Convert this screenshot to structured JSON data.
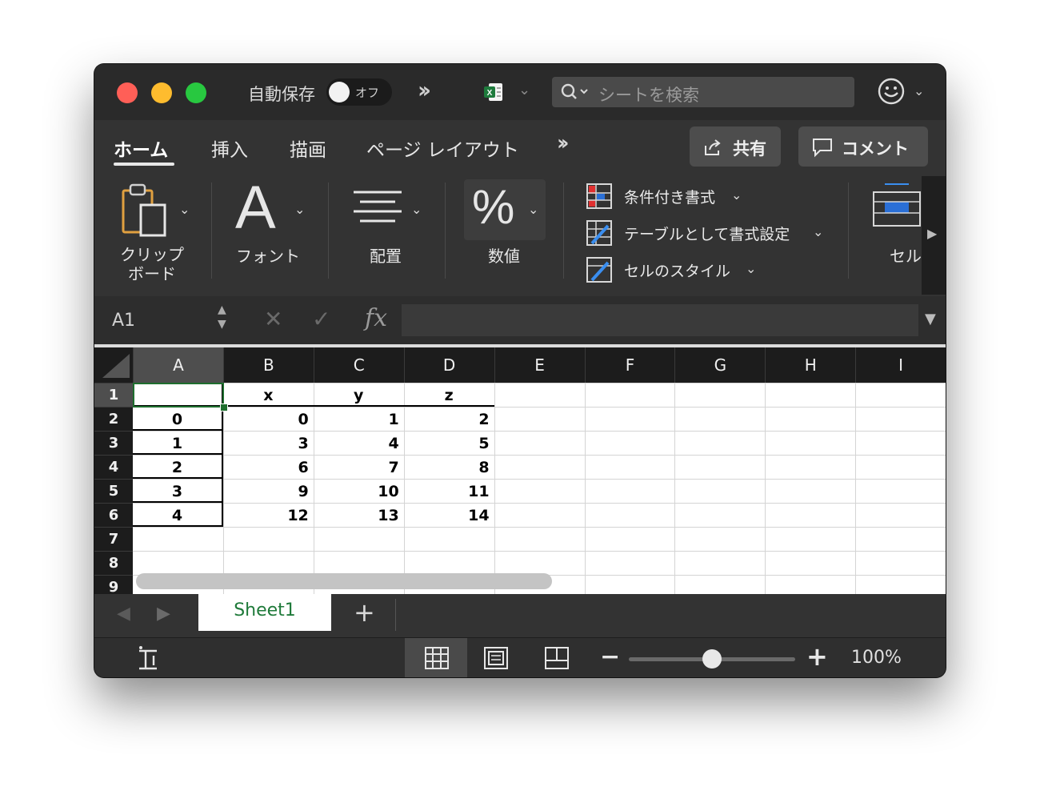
{
  "titlebar": {
    "autosave_label": "自動保存",
    "toggle_state": "オフ",
    "search_placeholder": "シートを検索"
  },
  "tabs": [
    "ホーム",
    "挿入",
    "描画",
    "ページ レイアウト"
  ],
  "actions": {
    "share": "共有",
    "comment": "コメント"
  },
  "ribbon": {
    "clipboard_line1": "クリップ",
    "clipboard_line2": "ボード",
    "font_glyph": "A",
    "font_label": "フォント",
    "align_label": "配置",
    "number_glyph": "%",
    "number_label": "数値",
    "styles": [
      "条件付き書式",
      "テーブルとして書式設定",
      "セルのスタイル"
    ],
    "cells_label": "セル"
  },
  "formula_bar": {
    "name_box": "A1",
    "fx": "fx",
    "content": ""
  },
  "grid": {
    "columns": [
      "A",
      "B",
      "C",
      "D",
      "E",
      "F",
      "G",
      "H",
      "I"
    ],
    "rows": [
      "1",
      "2",
      "3",
      "4",
      "5",
      "6",
      "7",
      "8",
      "9"
    ],
    "header_cells": [
      "",
      "x",
      "y",
      "z"
    ],
    "data": [
      [
        "0",
        "0",
        "1",
        "2"
      ],
      [
        "1",
        "3",
        "4",
        "5"
      ],
      [
        "2",
        "6",
        "7",
        "8"
      ],
      [
        "3",
        "9",
        "10",
        "11"
      ],
      [
        "4",
        "12",
        "13",
        "14"
      ]
    ],
    "selected_cell": "A1"
  },
  "sheets": {
    "active": "Sheet1"
  },
  "status": {
    "zoom": "100%",
    "zoom_value": 100
  }
}
